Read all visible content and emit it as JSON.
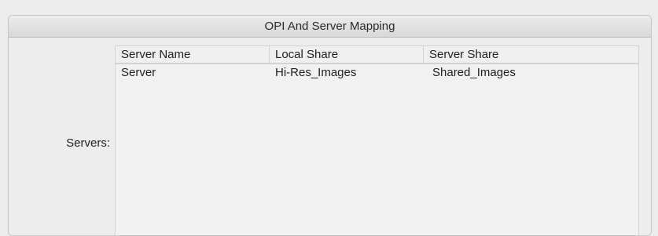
{
  "panel": {
    "title": "OPI And Server Mapping"
  },
  "servers": {
    "label": "Servers:",
    "columns": [
      "Server Name",
      "Local Share",
      "Server Share"
    ],
    "rows": [
      {
        "server_name": "Server",
        "local_share": "Hi-Res_Images",
        "server_share": "Shared_Images"
      }
    ]
  }
}
